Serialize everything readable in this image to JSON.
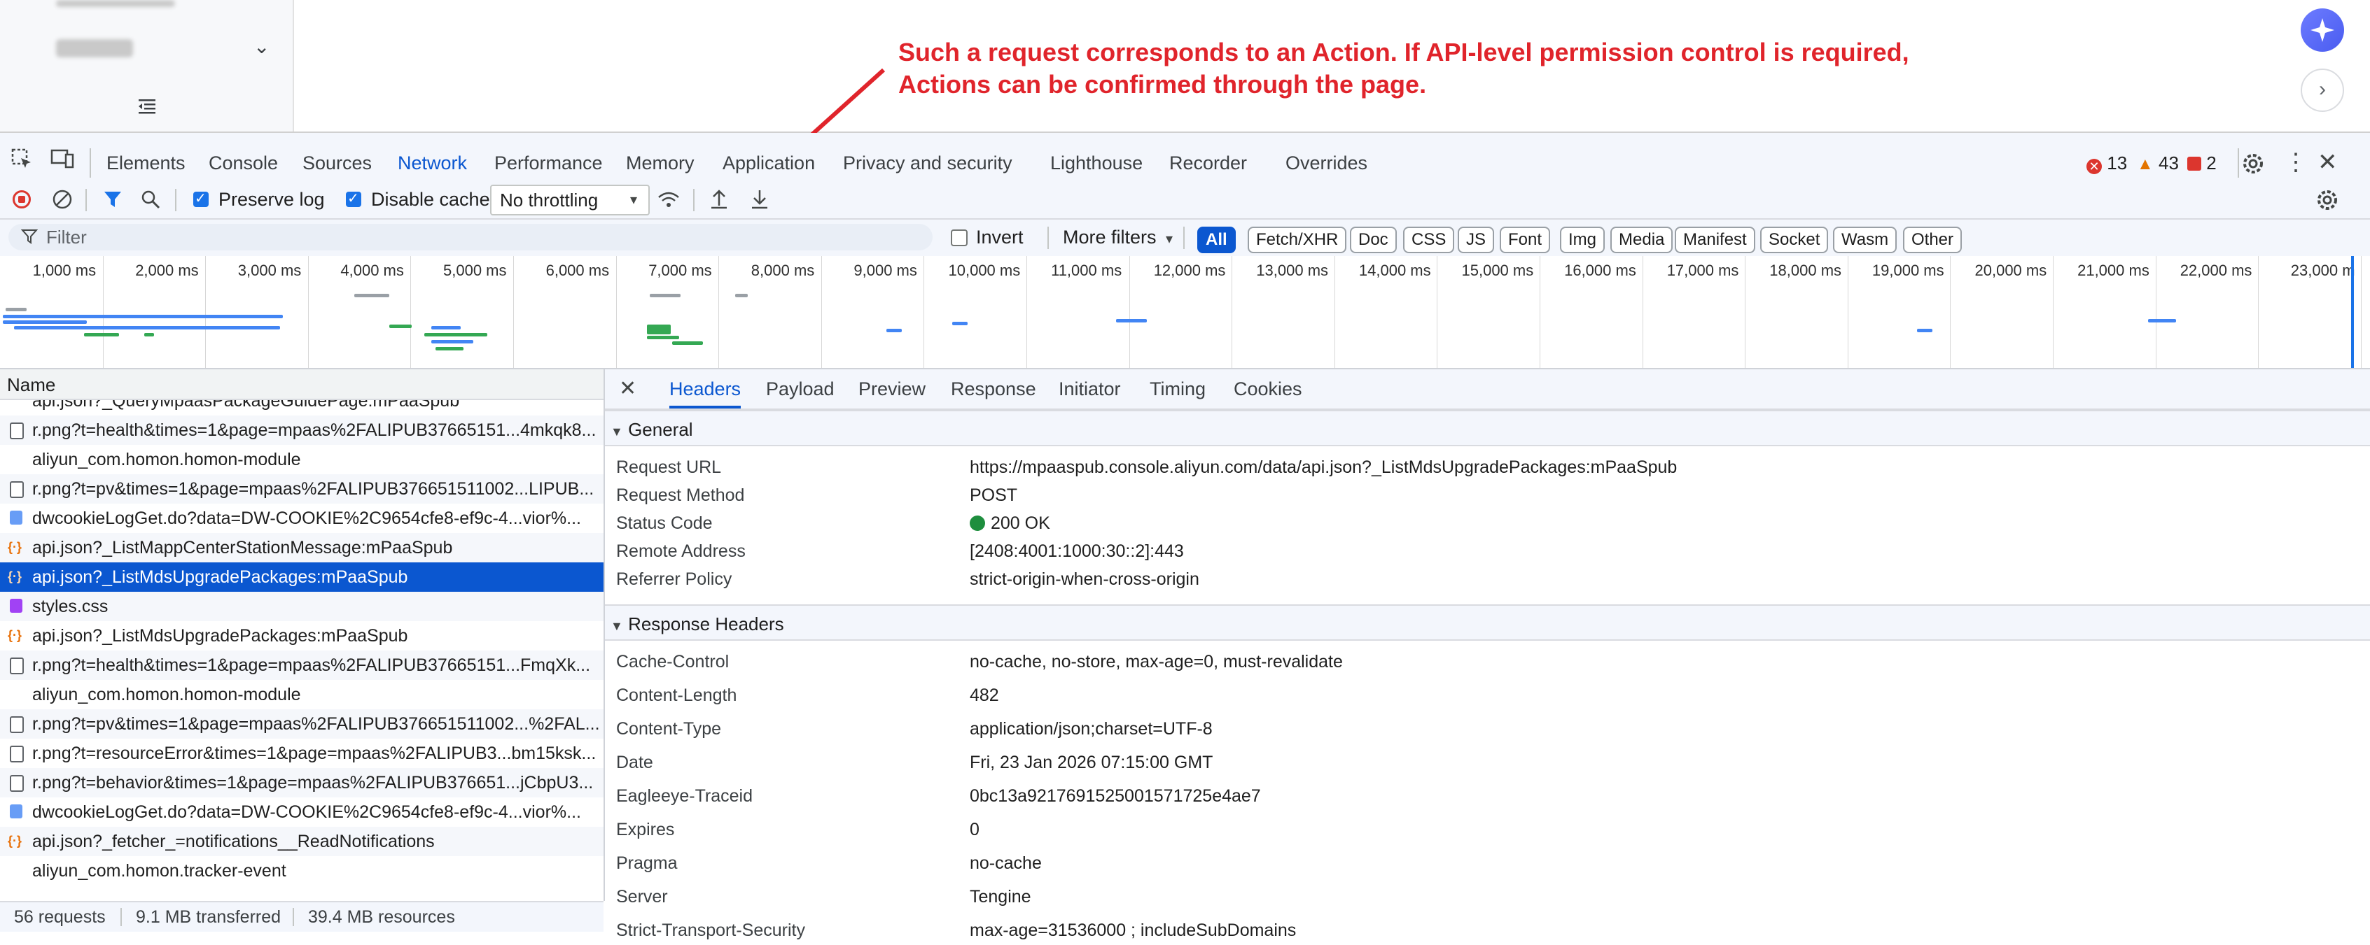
{
  "annotation": {
    "line1": "Such a request corresponds to an Action. If API-level permission control is required,",
    "line2": "Actions can be confirmed through the page."
  },
  "devtools": {
    "tabs": [
      "Elements",
      "Console",
      "Sources",
      "Network",
      "Performance",
      "Memory",
      "Application",
      "Privacy and security",
      "Lighthouse",
      "Recorder",
      "Overrides"
    ],
    "active_tab": "Network",
    "counts": {
      "errors": "13",
      "warnings": "43",
      "issues": "2"
    }
  },
  "network_toolbar": {
    "preserve_log": "Preserve log",
    "disable_cache": "Disable cache",
    "throttling": "No throttling"
  },
  "filter_bar": {
    "placeholder": "Filter",
    "invert": "Invert",
    "more_filters": "More filters",
    "chips": [
      "All",
      "Fetch/XHR",
      "Doc",
      "CSS",
      "JS",
      "Font",
      "Img",
      "Media",
      "Manifest",
      "Socket",
      "Wasm",
      "Other"
    ]
  },
  "timeline": {
    "ticks": [
      "1,000 ms",
      "2,000 ms",
      "3,000 ms",
      "4,000 ms",
      "5,000 ms",
      "6,000 ms",
      "7,000 ms",
      "8,000 ms",
      "9,000 ms",
      "10,000 ms",
      "11,000 ms",
      "12,000 ms",
      "13,000 ms",
      "14,000 ms",
      "15,000 ms",
      "16,000 ms",
      "17,000 ms",
      "18,000 ms",
      "19,000 ms",
      "20,000 ms",
      "21,000 ms",
      "22,000 ms",
      "23,000 m"
    ]
  },
  "request_list": {
    "header": "Name",
    "rows": [
      {
        "icon": "none",
        "name": "api.json?_QueryMpaasPackageGuidePage:mPaaSpub"
      },
      {
        "icon": "doc",
        "name": "r.png?t=health&times=1&page=mpaas%2FALIPUB37665151...4mkqk8..."
      },
      {
        "icon": "none",
        "name": "aliyun_com.homon.homon-module"
      },
      {
        "icon": "doc",
        "name": "r.png?t=pv&times=1&page=mpaas%2FALIPUB376651511002...LIPUB..."
      },
      {
        "icon": "script",
        "name": "dwcookieLogGet.do?data=DW-COOKIE%2C9654cfe8-ef9c-4...vior%..."
      },
      {
        "icon": "xhr",
        "name": "api.json?_ListMappCenterStationMessage:mPaaSpub"
      },
      {
        "icon": "xhr",
        "name": "api.json?_ListMdsUpgradePackages:mPaaSpub"
      },
      {
        "icon": "css",
        "name": "styles.css"
      },
      {
        "icon": "xhr",
        "name": "api.json?_ListMdsUpgradePackages:mPaaSpub"
      },
      {
        "icon": "doc",
        "name": "r.png?t=health&times=1&page=mpaas%2FALIPUB37665151...FmqXk..."
      },
      {
        "icon": "none",
        "name": "aliyun_com.homon.homon-module"
      },
      {
        "icon": "doc",
        "name": "r.png?t=pv&times=1&page=mpaas%2FALIPUB376651511002...%2FAL..."
      },
      {
        "icon": "doc",
        "name": "r.png?t=resourceError&times=1&page=mpaas%2FALIPUB3...bm15ksk..."
      },
      {
        "icon": "doc",
        "name": "r.png?t=behavior&times=1&page=mpaas%2FALIPUB376651...jCbpU3..."
      },
      {
        "icon": "script",
        "name": "dwcookieLogGet.do?data=DW-COOKIE%2C9654cfe8-ef9c-4...vior%..."
      },
      {
        "icon": "xhr",
        "name": "api.json?_fetcher_=notifications__ReadNotifications"
      },
      {
        "icon": "none",
        "name": "aliyun_com.homon.tracker-event"
      }
    ],
    "selected_index": 6
  },
  "status_bar": {
    "requests": "56 requests",
    "transferred": "9.1 MB transferred",
    "resources": "39.4 MB resources"
  },
  "details": {
    "tabs": [
      "Headers",
      "Payload",
      "Preview",
      "Response",
      "Initiator",
      "Timing",
      "Cookies"
    ],
    "active_tab": "Headers",
    "general": {
      "title": "General",
      "rows": [
        {
          "key": "Request URL",
          "value": "https://mpaaspub.console.aliyun.com/data/api.json?_ListMdsUpgradePackages:mPaaSpub"
        },
        {
          "key": "Request Method",
          "value": "POST"
        },
        {
          "key": "Status Code",
          "value": "200 OK"
        },
        {
          "key": "Remote Address",
          "value": "[2408:4001:1000:30::2]:443"
        },
        {
          "key": "Referrer Policy",
          "value": "strict-origin-when-cross-origin"
        }
      ]
    },
    "response_headers": {
      "title": "Response Headers",
      "rows": [
        {
          "key": "Cache-Control",
          "value": "no-cache, no-store, max-age=0, must-revalidate"
        },
        {
          "key": "Content-Length",
          "value": "482"
        },
        {
          "key": "Content-Type",
          "value": "application/json;charset=UTF-8"
        },
        {
          "key": "Date",
          "value": "Fri, 23 Jan 2026 07:15:00 GMT"
        },
        {
          "key": "Eagleeye-Traceid",
          "value": "0bc13a9217691525001571725e4ae7"
        },
        {
          "key": "Expires",
          "value": "0"
        },
        {
          "key": "Pragma",
          "value": "no-cache"
        },
        {
          "key": "Server",
          "value": "Tengine"
        },
        {
          "key": "Strict-Transport-Security",
          "value": "max-age=31536000 ; includeSubDomains"
        }
      ]
    }
  },
  "colors": {
    "accent": "#0b57d0",
    "annotation": "#e0242b",
    "selected_row": "#0b57d0"
  }
}
